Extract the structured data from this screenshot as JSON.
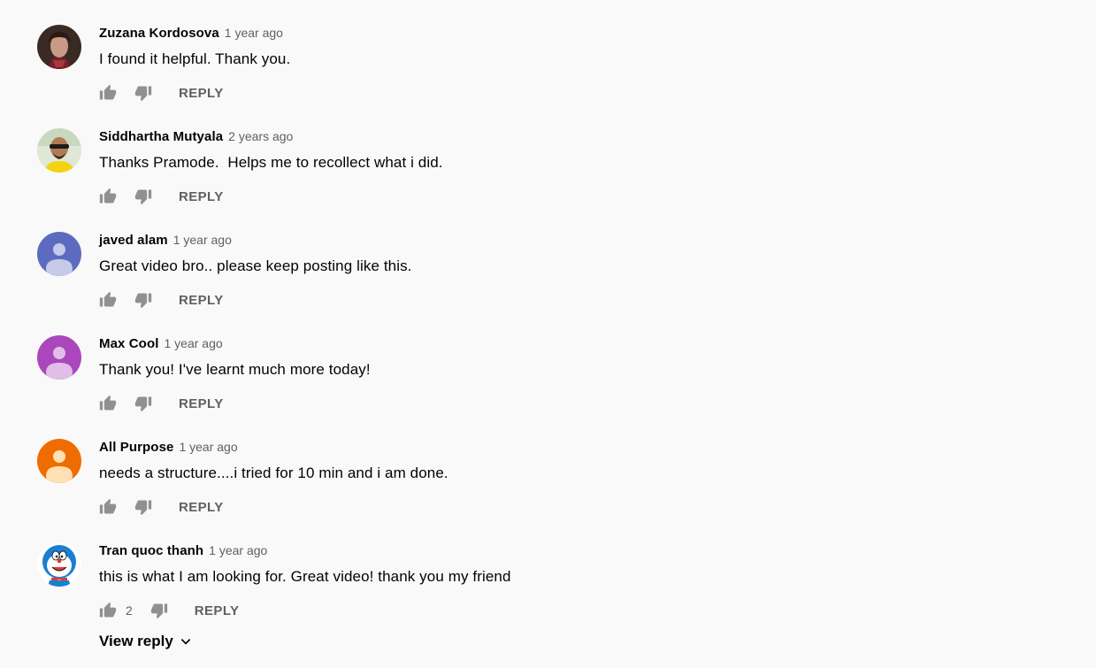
{
  "colors": {
    "background": "#f9f9f9",
    "text_primary": "#030303",
    "text_secondary": "#606060",
    "icon": "#909090",
    "avatar_blue": "#5c6bc0",
    "avatar_purple": "#ab47bc",
    "avatar_orange": "#ef6c00"
  },
  "reply_label": "REPLY",
  "view_replies_label": "View reply",
  "comments": [
    {
      "author": "Zuzana Kordosova",
      "time": "1 year ago",
      "text": "I found it helpful. Thank you.",
      "avatar": "photo-woman",
      "likes": ""
    },
    {
      "author": "Siddhartha Mutyala",
      "time": "2 years ago",
      "text": "Thanks Pramode.  Helps me to recollect what i did.",
      "avatar": "photo-man-sunglasses",
      "likes": ""
    },
    {
      "author": "javed alam",
      "time": "1 year ago",
      "text": "Great video bro.. please keep posting like this.",
      "avatar": "default-blue",
      "likes": ""
    },
    {
      "author": "Max Cool",
      "time": "1 year ago",
      "text": "Thank you! I've learnt much more today!",
      "avatar": "default-purple",
      "likes": ""
    },
    {
      "author": "All Purpose",
      "time": "1 year ago",
      "text": "needs a structure....i tried for 10 min and i am done.",
      "avatar": "default-orange",
      "likes": ""
    },
    {
      "author": "Tran quoc thanh",
      "time": "1 year ago",
      "text": "this is what I am looking for. Great video! thank you my friend",
      "avatar": "doraemon-cartoon",
      "likes": "2"
    }
  ]
}
